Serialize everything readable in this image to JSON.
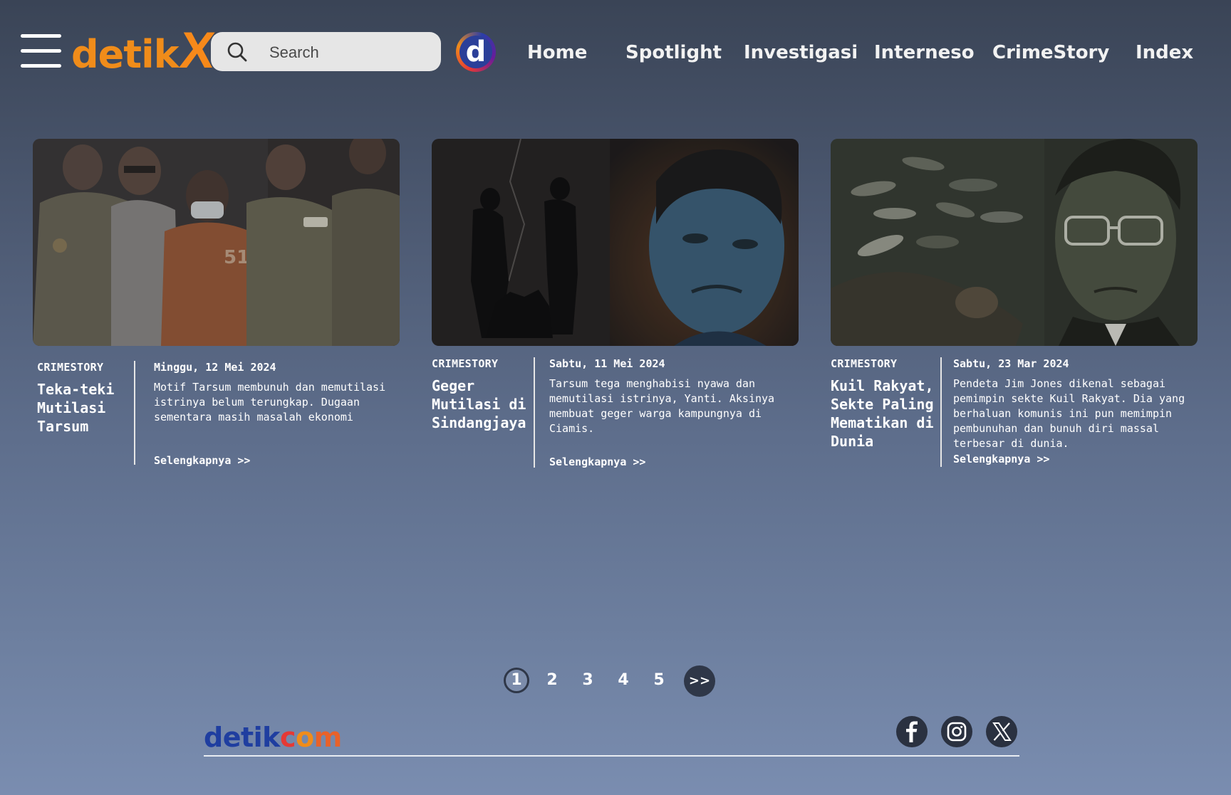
{
  "header": {
    "logo": {
      "main": "detik",
      "accent": "X"
    },
    "search": {
      "placeholder": "Search",
      "value": ""
    },
    "detik_d_label": "d",
    "nav": [
      {
        "label": "Home"
      },
      {
        "label": "Spotlight"
      },
      {
        "label": "Investigasi"
      },
      {
        "label": "Interneso"
      },
      {
        "label": "CrimeStory"
      },
      {
        "label": "Index"
      }
    ]
  },
  "cards": [
    {
      "category": "CRIMESTORY",
      "title": "Teka-teki Mutilasi Tarsum",
      "date": "Minggu, 12 Mei 2024",
      "description": "Motif Tarsum membunuh dan memutilasi istrinya belum terungkap. Dugaan sementara masih masalah ekonomi",
      "more": "Selengkapnya >>",
      "image": "police-escorting-suspect-photo"
    },
    {
      "category": "CRIMESTORY",
      "title": "Geger Mutilasi di Sindangjaya",
      "date": "Sabtu, 11 Mei 2024",
      "description": "Tarsum tega menghabisi nyawa dan memutilasi istrinya, Yanti. Aksinya membuat geger warga kampungnya di Ciamis.",
      "more": "Selengkapnya >>",
      "image": "illustration-silhouettes-and-face"
    },
    {
      "category": "CRIMESTORY",
      "title": "Kuil Rakyat, Sekte Paling Mematikan di Dunia",
      "date": "Sabtu, 23 Mar 2024",
      "description": "Pendeta Jim Jones dikenal sebagai pemimpin sekte Kuil Rakyat. Dia yang berhaluan komunis ini pun memimpin pembunuhan dan bunuh diri massal terbesar di dunia.",
      "more": "Selengkapnya >>",
      "image": "illustration-cult-leader-and-bodies"
    }
  ],
  "pagination": {
    "pages": [
      "1",
      "2",
      "3",
      "4",
      "5"
    ],
    "current": "1",
    "next": ">>"
  },
  "footer": {
    "logo": {
      "detik": "detik",
      "c": "c",
      "o": "o",
      "m": "m"
    },
    "social": [
      {
        "icon": "facebook-icon"
      },
      {
        "icon": "instagram-icon"
      },
      {
        "icon": "x-twitter-icon"
      }
    ]
  },
  "colors": {
    "accent_orange": "#f08c1a",
    "footer_blue": "#1f3ea0",
    "dark_circle": "#2f3748"
  }
}
